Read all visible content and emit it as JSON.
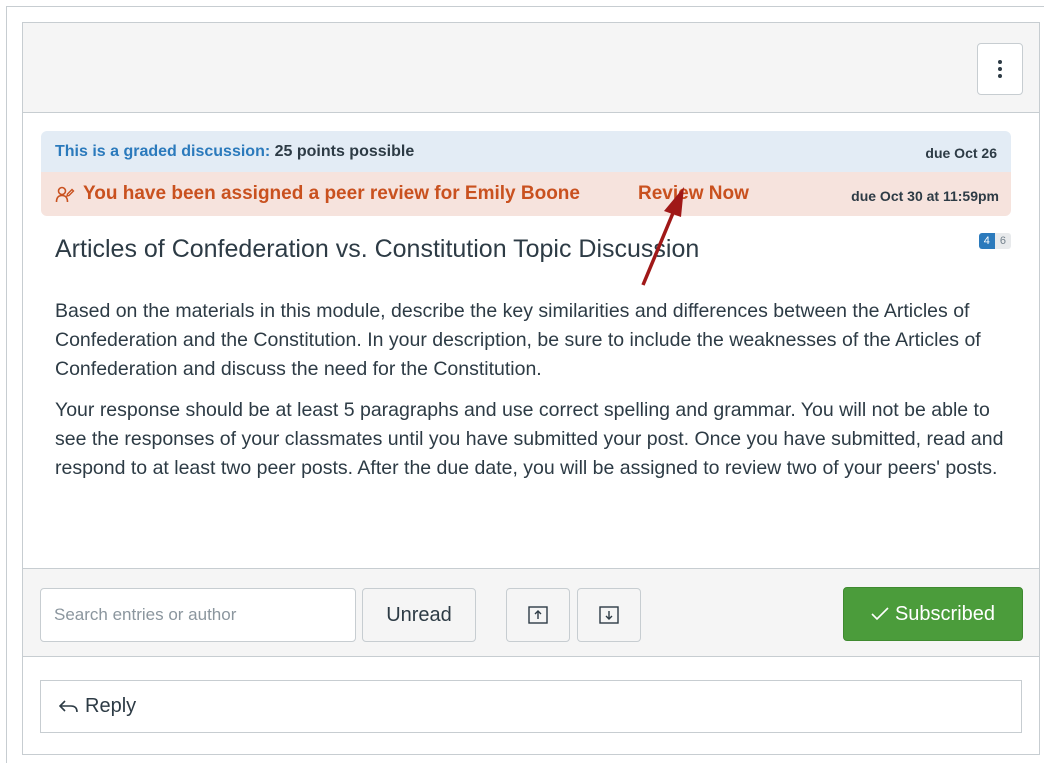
{
  "header": {
    "options_icon": "kebab-vertical-icon"
  },
  "graded": {
    "label": "This is a graded discussion:",
    "points": "25 points possible",
    "due": "due Oct 26"
  },
  "peer_review": {
    "icon": "peer-review-icon",
    "text": "You have been assigned a peer review for Emily Boone",
    "link": "Review Now",
    "due": "due Oct 30 at 11:59pm"
  },
  "topic": {
    "title": "Articles of Confederation vs. Constitution Topic Discussion",
    "unread_count": "4",
    "total_count": "6",
    "paragraphs": [
      "Based on the materials in this module, describe the key similarities and differences between the Articles of Confederation and the Constitution. In your description, be sure to include the weaknesses of the Articles of Confederation and discuss the need for the Constitution.",
      "Your response should be at least 5 paragraphs and use correct spelling and grammar. You will not be able to see the responses of your classmates until you have submitted your post. Once you have submitted, read and respond to at least two peer posts. After the due date, you will be assigned to review two of your peers' posts."
    ]
  },
  "toolbar": {
    "search_placeholder": "Search entries or author",
    "unread_label": "Unread",
    "collapse_icon": "collapse-up-icon",
    "expand_icon": "expand-down-icon",
    "subscribed_label": "Subscribed"
  },
  "reply": {
    "label": "Reply",
    "icon": "reply-arrow-icon"
  },
  "colors": {
    "graded_bg": "#e3ecf5",
    "graded_label": "#2b7abc",
    "peer_bg": "#f6e3dd",
    "peer_text": "#c9511f",
    "subscribed_bg": "#4b9c3b",
    "annotation_arrow": "#a01818"
  }
}
